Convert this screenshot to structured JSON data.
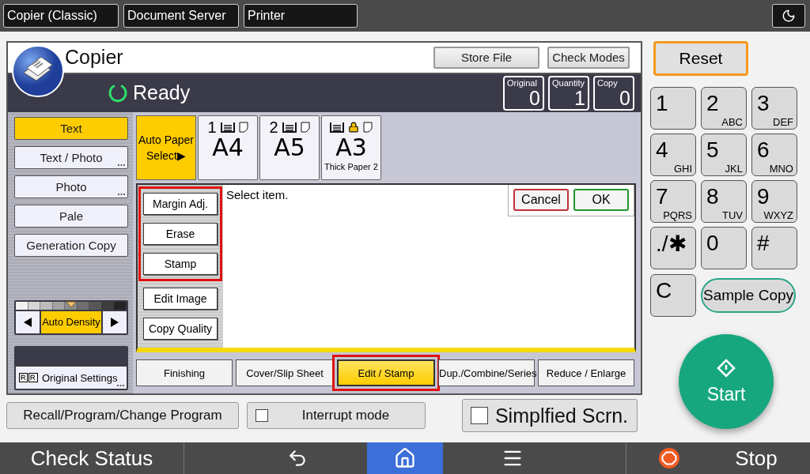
{
  "top_tabs": [
    {
      "label": "Copier (Classic)"
    },
    {
      "label": "Document Server"
    },
    {
      "label": "Printer"
    }
  ],
  "copier": {
    "title": "Copier",
    "status": "Ready",
    "header_buttons": [
      "Store File",
      "Check Modes"
    ],
    "counters": [
      {
        "label": "Original",
        "value": "0"
      },
      {
        "label": "Quantity",
        "value": "1"
      },
      {
        "label": "Copy",
        "value": "0"
      }
    ],
    "original_types": [
      {
        "label": "Text",
        "selected": true,
        "more": false
      },
      {
        "label": "Text / Photo",
        "selected": false,
        "more": true
      },
      {
        "label": "Photo",
        "selected": false,
        "more": true
      },
      {
        "label": "Pale",
        "selected": false,
        "more": false
      },
      {
        "label": "Generation Copy",
        "selected": false,
        "more": false
      }
    ],
    "density": {
      "label": "Auto Density",
      "level": 0.5
    },
    "original_settings": {
      "label": "Original Settings",
      "more": true
    },
    "paper": {
      "auto": {
        "lines": [
          "Auto Paper",
          "Select▶"
        ],
        "selected": true
      },
      "trays": [
        {
          "number": "1",
          "size": "A4",
          "locked": false
        },
        {
          "number": "2",
          "size": "A5",
          "locked": false
        },
        {
          "size": "A3",
          "note": "Thick Paper 2",
          "locked": true
        }
      ]
    },
    "edit_items": [
      {
        "label": "Margin Adj.",
        "highlighted": true
      },
      {
        "label": "Erase",
        "highlighted": true
      },
      {
        "label": "Stamp",
        "highlighted": true
      },
      {
        "label": "Edit Image",
        "highlighted": false
      },
      {
        "label": "Copy Quality",
        "highlighted": false
      }
    ],
    "message": "Select item.",
    "dialog_buttons": [
      {
        "label": "Cancel",
        "kind": "cancel"
      },
      {
        "label": "OK",
        "kind": "ok"
      }
    ],
    "function_tabs": [
      {
        "label": "Finishing",
        "selected": false,
        "highlighted": false
      },
      {
        "label": "Cover/Slip Sheet",
        "selected": false,
        "highlighted": false
      },
      {
        "label": "Edit / Stamp",
        "selected": true,
        "highlighted": true
      },
      {
        "label": "Dup./Combine/Series",
        "selected": false,
        "highlighted": false
      },
      {
        "label": "Reduce / Enlarge",
        "selected": false,
        "highlighted": false
      }
    ]
  },
  "bottom_buttons": [
    {
      "label": "Recall/Program/Change Program",
      "kind": "button"
    },
    {
      "label": "Interrupt mode",
      "kind": "checkbox",
      "checked": false
    },
    {
      "label": "Simplfied Scrn.",
      "kind": "large-checkbox",
      "checked": false
    }
  ],
  "keypad": {
    "reset": "Reset",
    "keys": [
      {
        "digit": "1"
      },
      {
        "digit": "2",
        "letters": "ABC"
      },
      {
        "digit": "3",
        "letters": "DEF"
      },
      {
        "digit": "4",
        "letters": "GHI"
      },
      {
        "digit": "5",
        "letters": "JKL"
      },
      {
        "digit": "6",
        "letters": "MNO"
      },
      {
        "digit": "7",
        "letters": "PQRS"
      },
      {
        "digit": "8",
        "letters": "TUV"
      },
      {
        "digit": "9",
        "letters": "WXYZ"
      },
      {
        "digit": "./✱"
      },
      {
        "digit": "0"
      },
      {
        "digit": "#"
      }
    ],
    "clear": "C",
    "sample_copy": "Sample Copy",
    "start": "Start"
  },
  "nav_bar": {
    "check_status": "Check Status",
    "stop": "Stop",
    "items": [
      {
        "kind": "back",
        "selected": false
      },
      {
        "kind": "home",
        "selected": true
      },
      {
        "kind": "menu",
        "selected": false
      }
    ]
  }
}
